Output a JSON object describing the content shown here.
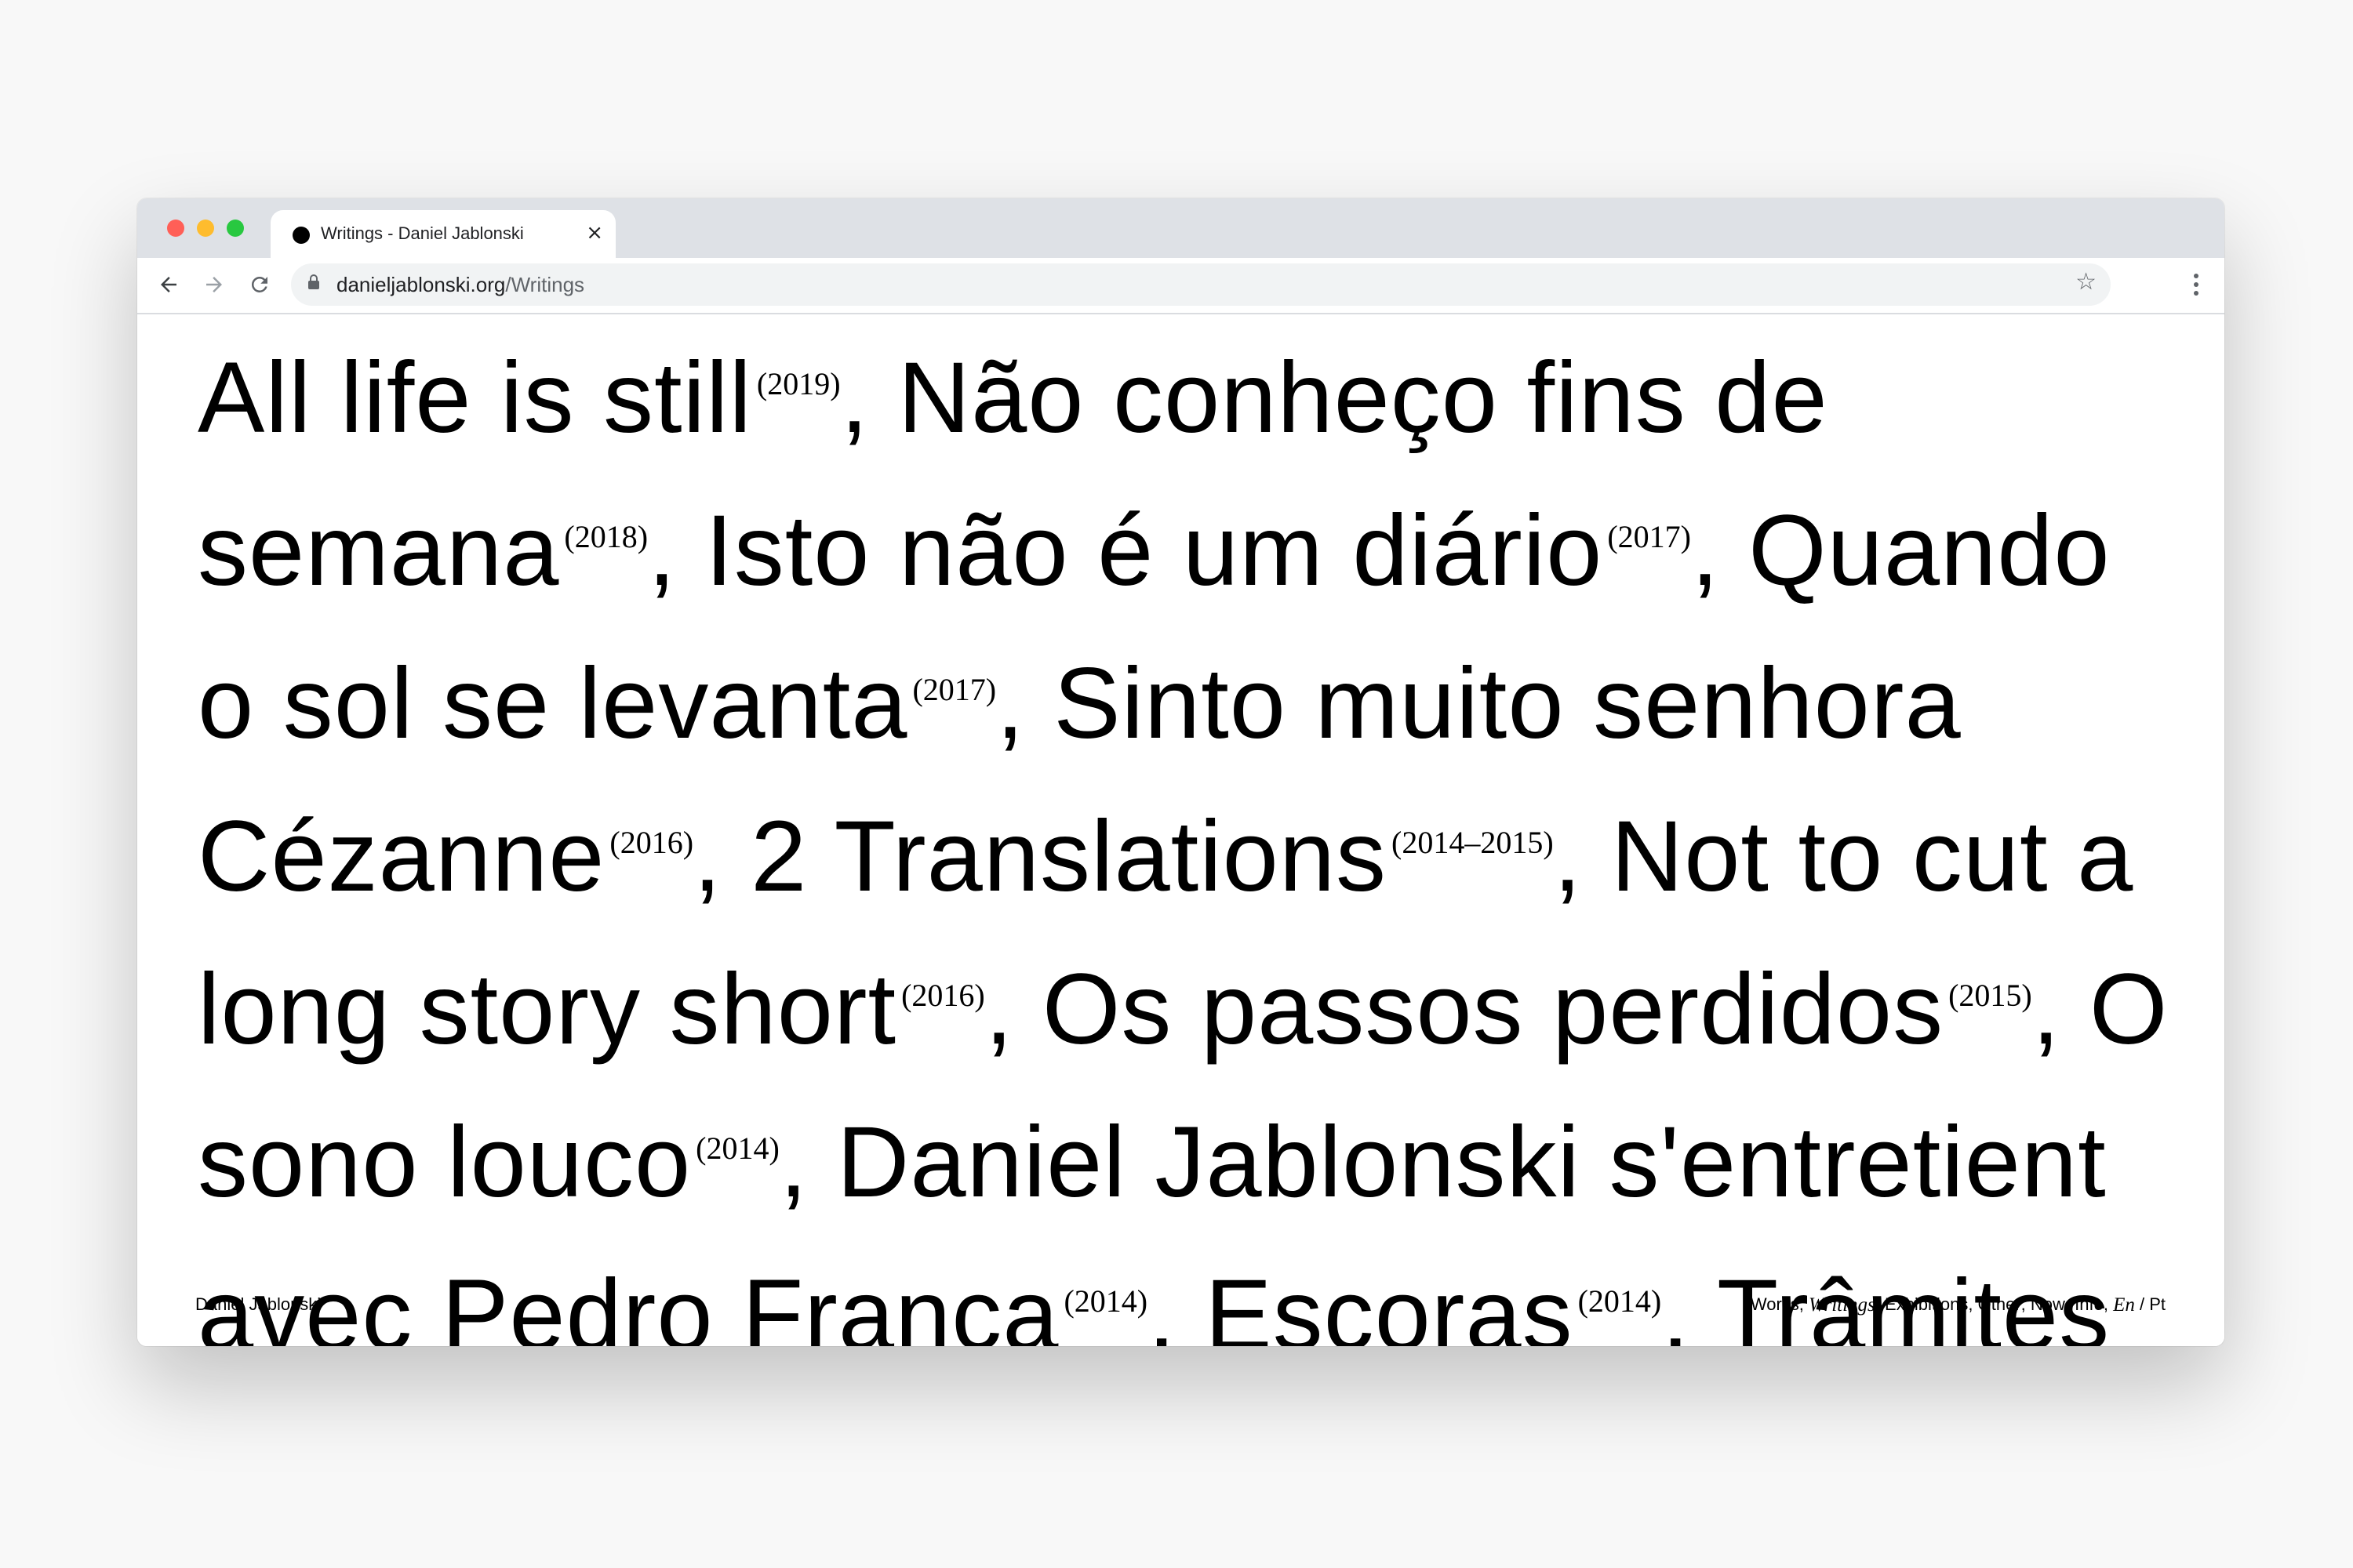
{
  "browser": {
    "tab_title": "Writings - Daniel Jablonski",
    "tab_close": "×",
    "url_host": "danieljablonski.org",
    "url_path": "/Writings"
  },
  "icons": {
    "back": "back-arrow-icon",
    "forward": "forward-arrow-icon",
    "reload": "reload-icon",
    "lock": "lock-icon",
    "star": "bookmark-star-icon",
    "menu": "kebab-menu-icon"
  },
  "colors": {
    "traffic_red": "#ff5f57",
    "traffic_yellow": "#febc2e",
    "traffic_green": "#28c840",
    "tabstrip": "#dee1e6",
    "text": "#000000"
  },
  "writings": [
    {
      "title": "All life is still",
      "year": "(2019)"
    },
    {
      "title": "Não conheço fins de semana",
      "year": "(2018)"
    },
    {
      "title": "Isto não é um diário",
      "year": "(2017)"
    },
    {
      "title": "Quando o sol se levanta",
      "year": "(2017)"
    },
    {
      "title": "Sinto muito senhora Cézanne",
      "year": "(2016)"
    },
    {
      "title": "2 Translations",
      "year": "(2014–2015)"
    },
    {
      "title": "Not to cut a long story short",
      "year": "(2016)"
    },
    {
      "title": "Os passos perdidos",
      "year": "(2015)"
    },
    {
      "title": "O sono louco",
      "year": "(2014)"
    },
    {
      "title": "Daniel Jablonski s'entretient avec Pedro França",
      "year": "(2014)"
    },
    {
      "title": "Escoras",
      "year": "(2014)"
    },
    {
      "title": "Trâmites",
      "year": ""
    }
  ],
  "footer": {
    "name": "Daniel Jablonski",
    "nav": {
      "works": "Works",
      "writings": "Writings",
      "exhibitions": "Exhibitions",
      "other": "Other",
      "now": "Now",
      "info": "Info",
      "lang_en": "En",
      "lang_pt": "Pt"
    }
  }
}
